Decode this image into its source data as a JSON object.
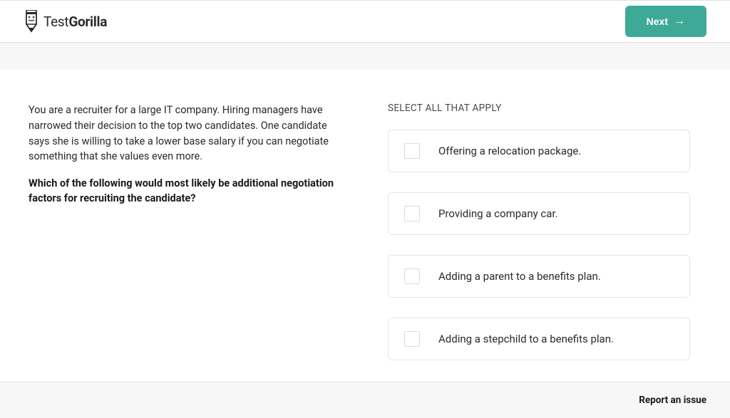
{
  "header": {
    "logo_text_1": "Test",
    "logo_text_2": "Gorilla",
    "next_label": "Next"
  },
  "question": {
    "scenario": "You are a recruiter for a large IT company. Hiring managers have narrowed their decision to the top two candidates. One candidate says she is willing to take a lower base salary if you can negotiate something that she values even more.",
    "prompt": "Which of the following would most likely be additional negotiation factors for recruiting the candidate?",
    "instruction": "SELECT ALL THAT APPLY",
    "options": [
      "Offering a relocation package.",
      "Providing a company car.",
      "Adding a parent to a benefits plan.",
      "Adding a stepchild to a benefits plan."
    ]
  },
  "footer": {
    "report_label": "Report an issue"
  }
}
